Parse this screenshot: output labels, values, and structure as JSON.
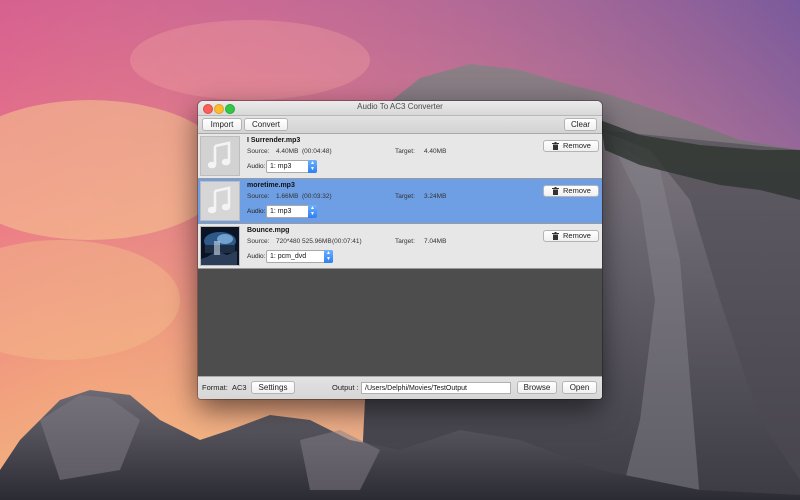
{
  "window": {
    "title": "Audio To AC3 Converter"
  },
  "toolbar": {
    "import_label": "Import",
    "convert_label": "Convert",
    "clear_label": "Clear"
  },
  "files": [
    {
      "name": "I Surrender.mp3",
      "source_label": "Source:",
      "source_size": "4.40MB",
      "source_duration": "(00:04:48)",
      "target_label": "Target:",
      "target_size": "4.40MB",
      "audio_label": "Audio:",
      "audio_track": "1: mp3",
      "remove_label": "Remove",
      "thumb_icon": "music-note-icon",
      "selected": false
    },
    {
      "name": "moretime.mp3",
      "source_label": "Source:",
      "source_size": "1.66MB",
      "source_duration": "(00:03:32)",
      "target_label": "Target:",
      "target_size": "3.24MB",
      "audio_label": "Audio:",
      "audio_track": "1: mp3",
      "remove_label": "Remove",
      "thumb_icon": "music-note-icon",
      "selected": true
    },
    {
      "name": "Bounce.mpg",
      "source_label": "Source:",
      "source_size": "720*480  525.96MB",
      "source_duration": "(00:07:41)",
      "target_label": "Target:",
      "target_size": "7.04MB",
      "audio_label": "Audio:",
      "audio_track": "1: pcm_dvd",
      "remove_label": "Remove",
      "thumb_icon": "video-thumbnail",
      "selected": false
    }
  ],
  "bottom": {
    "format_label": "Format:",
    "format_value": "AC3",
    "settings_label": "Settings",
    "output_label": "Output :",
    "output_path": "/Users/Delphi/Movies/TestOutput",
    "browse_label": "Browse",
    "open_label": "Open"
  },
  "colors": {
    "selected_row": "#6e9ee3",
    "list_background": "#4d4d4d",
    "select_arrow": "#2f7ff0"
  }
}
